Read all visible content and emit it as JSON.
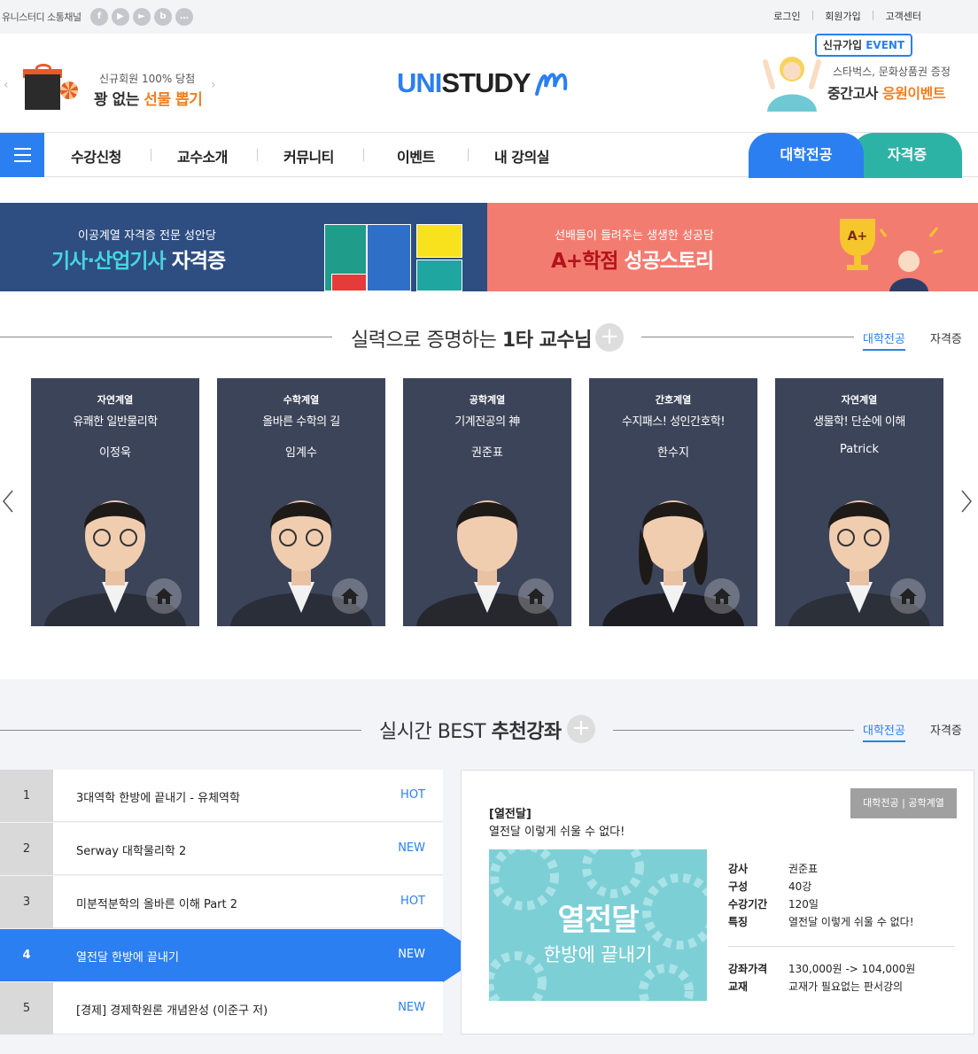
{
  "topbar": {
    "social_label": "유니스터디 소통채널",
    "social_icons": [
      "facebook-icon",
      "youtube-icon",
      "play-icon",
      "blog-icon",
      "talk-icon"
    ],
    "links": [
      "로그인",
      "회원가입",
      "고객센터"
    ]
  },
  "header": {
    "promo_sub": "신규회원 100% 당첨",
    "promo_main_a": "꽝 없는 ",
    "promo_main_b": "선물 뽑기",
    "logo_a": "UNI",
    "logo_b": "STUDY",
    "event_tag_a": "신규가입 ",
    "event_tag_b": "EVENT",
    "event_sub": "스타벅스, 문화상품권 증정",
    "event_main_a": "중간고사 ",
    "event_main_b": "응원이벤트"
  },
  "nav": {
    "items": [
      "수강신청",
      "교수소개",
      "커뮤니티",
      "이벤트",
      "내 강의실"
    ],
    "tab_major": "대학전공",
    "tab_cert": "자격증"
  },
  "banners": {
    "left_sub": "이공계열 자격증 전문 성안당",
    "left_main_a": "기사·산업기사",
    "left_main_b": " 자격증",
    "right_sub": "선배들이 들려주는 생생한 성공담",
    "right_main_a": "A+학점",
    "right_main_b": " 성공스토리"
  },
  "professors": {
    "title_a": "실력으로 증명하는 ",
    "title_b": "1타 교수님",
    "tabs": [
      "대학전공",
      "자격증"
    ],
    "cards": [
      {
        "category": "자연계열",
        "course": "유쾌한 일반물리학",
        "name": "이정욱"
      },
      {
        "category": "수학계열",
        "course": "올바른 수학의 길",
        "name": "임계수"
      },
      {
        "category": "공학계열",
        "course": "기계전공의 神",
        "name": "권준표"
      },
      {
        "category": "간호계열",
        "course": "수지패스! 성인간호학!",
        "name": "한수지"
      },
      {
        "category": "자연계열",
        "course": "생물학! 단순에 이해",
        "name": "Patrick"
      }
    ]
  },
  "best": {
    "title_a": "실시간 BEST ",
    "title_b": "추천강좌",
    "tabs": [
      "대학전공",
      "자격증"
    ],
    "rows": [
      {
        "num": "1",
        "title": "3대역학 한방에 끝내기 - 유체역학",
        "tag": "HOT"
      },
      {
        "num": "2",
        "title": "Serway 대학물리학 2",
        "tag": "NEW"
      },
      {
        "num": "3",
        "title": "미분적분학의 올바른 이해 Part 2",
        "tag": "HOT"
      },
      {
        "num": "4",
        "title": "열전달 한방에 끝내기",
        "tag": "NEW"
      },
      {
        "num": "5",
        "title": "[경제] 경제학원론 개념완성 (이준구 저)",
        "tag": "NEW"
      }
    ],
    "detail": {
      "badge": "대학전공 | 공학계열",
      "title": "[열전달]",
      "desc": "열전달 이렇게 쉬울 수 없다!",
      "thumb_title": "열전달",
      "thumb_sub": "한방에 끝내기",
      "info": [
        {
          "k": "강사",
          "v": "권준표"
        },
        {
          "k": "구성",
          "v": "40강"
        },
        {
          "k": "수강기간",
          "v": "120일"
        },
        {
          "k": "특징",
          "v": "열전달 이렇게 쉬울 수 없다!"
        }
      ],
      "price": [
        {
          "k": "강좌가격",
          "v": "130,000원 -> 104,000원"
        },
        {
          "k": "교재",
          "v": "교재가 필요없는 판서강의"
        }
      ]
    }
  },
  "colors": {
    "accent": "#2b7ff0",
    "teal": "#2db3a5",
    "navy": "#2e4d80",
    "coral": "#f37c70",
    "orange": "#f07f20"
  }
}
